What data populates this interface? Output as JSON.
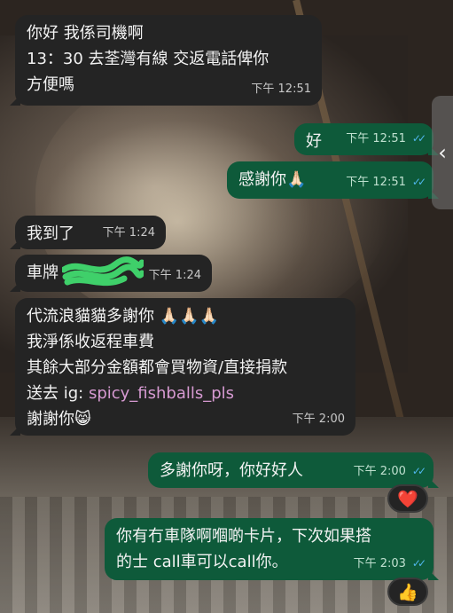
{
  "messages": [
    {
      "dir": "in",
      "text": "你好 我係司機啊\n13：30 去荃灣有線 交返電話俾你\n方便嗎",
      "time": "下午 12:51"
    },
    {
      "dir": "out",
      "text": "好",
      "time": "下午 12:51"
    },
    {
      "dir": "out",
      "text": "感謝你🙏🏻",
      "time": "下午 12:51"
    },
    {
      "dir": "in",
      "text": "我到了",
      "time": "下午 1:24"
    },
    {
      "dir": "in",
      "text": "車牌",
      "time": "下午 1:24"
    },
    {
      "dir": "in",
      "text_parts": [
        "代流浪貓貓多謝你 🙏🏻🙏🏻🙏🏻\n我淨係收返程車費\n其餘大部分金額都會買物資/直接捐款\n送去 ig: ",
        "spicy_fishballs_pls",
        "\n謝謝你😸"
      ],
      "time": "下午 2:00"
    },
    {
      "dir": "out",
      "text": "多謝你呀，你好好人",
      "time": "下午 2:00",
      "reaction": "❤️"
    },
    {
      "dir": "out",
      "text": "你有冇車隊啊嗰啲卡片，下次如果搭\n的士 call車可以call你。",
      "time": "下午 2:03",
      "reaction": "👍"
    }
  ],
  "ui": {
    "side_handle_icon": "chevron-left-icon",
    "side_handle_glyph": "‹",
    "tick_glyph": "✓✓",
    "colors": {
      "incoming": "#242424",
      "outgoing": "#0e5a3a",
      "ticks": "#4fb6ec",
      "link": "#d79ad2"
    }
  }
}
